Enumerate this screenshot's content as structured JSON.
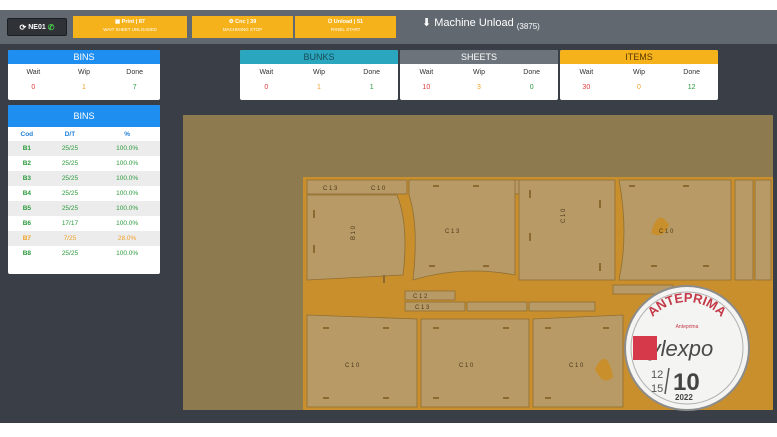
{
  "toolbar": {
    "machine_btn": "NE01",
    "print": {
      "line1": "Print | 87",
      "line2": "WAIT SHEET UNLOADED"
    },
    "cnc": {
      "line1": "Cnc | 39",
      "line2": "MACHINING STOP"
    },
    "unload": {
      "line1": "Unload | 51",
      "line2": "PANEL START"
    },
    "title": "Machine Unload",
    "count": "(3875)"
  },
  "summary": {
    "labels": {
      "wait": "Wait",
      "wip": "Wip",
      "done": "Done"
    },
    "bins": {
      "title": "BINS",
      "wait": "0",
      "wip": "1",
      "done": "7"
    },
    "bunks": {
      "title": "BUNKS",
      "wait": "0",
      "wip": "1",
      "done": "1"
    },
    "sheets": {
      "title": "SHEETS",
      "wait": "10",
      "wip": "3",
      "done": "0"
    },
    "items": {
      "title": "ITEMS",
      "wait": "30",
      "wip": "0",
      "done": "12"
    }
  },
  "bins_list": {
    "title": "BINS",
    "columns": [
      "Cod",
      "D/T",
      "%"
    ],
    "rows": [
      {
        "cod": "B1",
        "dt": "25/25",
        "pct": "100.0%"
      },
      {
        "cod": "B2",
        "dt": "25/25",
        "pct": "100.0%"
      },
      {
        "cod": "B3",
        "dt": "25/25",
        "pct": "100.0%"
      },
      {
        "cod": "B4",
        "dt": "25/25",
        "pct": "100.0%"
      },
      {
        "cod": "B5",
        "dt": "25/25",
        "pct": "100.0%"
      },
      {
        "cod": "B6",
        "dt": "17/17",
        "pct": "100.0%"
      },
      {
        "cod": "B7",
        "dt": "7/25",
        "pct": "28.0%"
      },
      {
        "cod": "B8",
        "dt": "25/25",
        "pct": "100.0%"
      }
    ]
  },
  "sheet_labels": {
    "top_a": "C 1 3",
    "top_b": "C 1 0",
    "mid_a": "B 1 0",
    "mid_b": "C 1 2",
    "mid_c": "C 1 3",
    "mid_d": "C 1 0",
    "mid_e": "C 1 3",
    "right_a": "C 1 0",
    "bot_a": "C 1 0",
    "bot_b": "C 1 0",
    "bot_c": "C 1 0"
  },
  "stamp": {
    "top": "ANTEPRIMA",
    "sub": "Anteprima",
    "brand": "Xylexpo",
    "dates_top": "12",
    "dates_bottom": "15",
    "day": "10",
    "year": "2022"
  },
  "colors": {
    "bins_head": "#1f8ef1",
    "bunks_head": "#2aa6bf",
    "sheets_head": "#6c737b",
    "items_head": "#f6b21a",
    "toolbar_yellow": "#f6b21a"
  }
}
